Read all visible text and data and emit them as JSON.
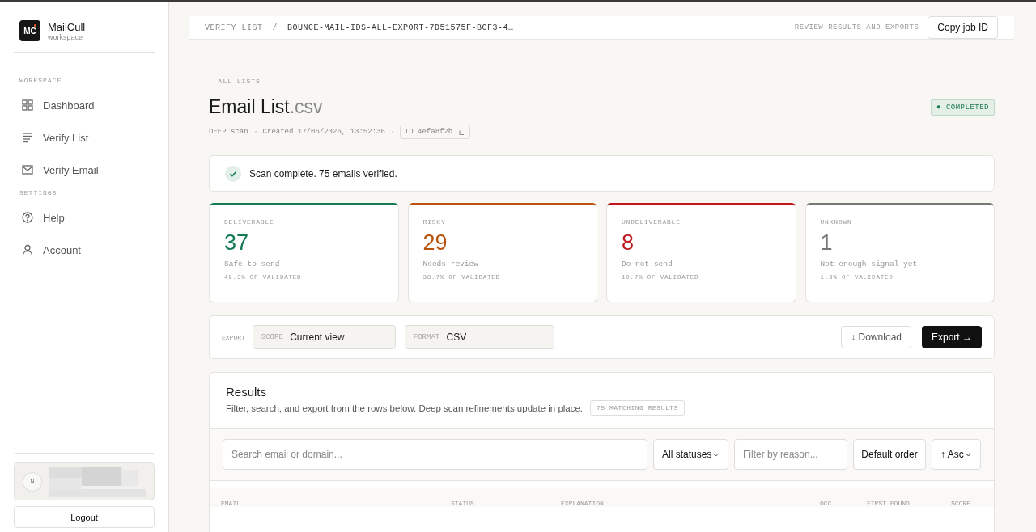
{
  "sidebar": {
    "logo": "MC",
    "brand": "MailCull",
    "subtitle": "workspace",
    "sections": [
      {
        "heading": "WORKSPACE",
        "items": [
          {
            "label": "Dashboard",
            "kind": "grid",
            "selected": false
          },
          {
            "label": "Verify List",
            "kind": "lines",
            "selected": false
          },
          {
            "label": "Verify Email",
            "kind": "mail",
            "selected": false
          }
        ]
      },
      {
        "heading": "SETTINGS",
        "items": [
          {
            "label": "Help",
            "kind": "help",
            "selected": false
          },
          {
            "label": "Account",
            "kind": "user",
            "selected": false
          }
        ]
      }
    ],
    "user": {
      "initial": "N"
    },
    "logout": "Logout"
  },
  "topbar": {
    "crumb": "VERIFY LIST",
    "separator": "/",
    "current": "BOUNCE-MAIL-IDS-ALL-EXPORT-7D51575F-BCF3-4…",
    "hint": "REVIEW RESULTS AND EXPORTS",
    "button": "Copy job ID"
  },
  "header": {
    "back": "← ALL LISTS",
    "name": "Email List",
    "ext": ".csv",
    "status": "● COMPLETED",
    "scan": "DEEP scan",
    "created": "Created 17/06/2026, 13:52:36",
    "id": "ID 4efa8f2b…"
  },
  "notice": "Scan complete. 75 emails verified.",
  "stats": [
    {
      "label": "DELIVERABLE",
      "value": "37",
      "note": "Safe to send",
      "share": "49.3% OF VALIDATED",
      "color": "#137a52"
    },
    {
      "label": "RISKY",
      "value": "29",
      "note": "Needs review",
      "share": "38.7% OF VALIDATED",
      "color": "#b8530f"
    },
    {
      "label": "UNDELIVERABLE",
      "value": "8",
      "note": "Do not send",
      "share": "10.7% OF VALIDATED",
      "color": "#c0161c"
    },
    {
      "label": "UNKNOWN",
      "value": "1",
      "note": "Not enough signal yet",
      "share": "1.3% OF VALIDATED",
      "color": "#777777"
    }
  ],
  "export": {
    "label": "EXPORT",
    "scope_label": "SCOPE",
    "scope": "Current view",
    "format_label": "FORMAT",
    "format": "CSV",
    "download": "↓ Download",
    "export": "Export →"
  },
  "results": {
    "title": "Results",
    "description": "Filter, search, and export from the rows below. Deep scan refinements update in place.",
    "count": "75 MATCHING RESULTS",
    "search_placeholder": "Search email or domain...",
    "status_filter": "All statuses",
    "reason_placeholder": "Filter by reason...",
    "order": "Default order",
    "direction": "↑ Asc",
    "columns": [
      "EMAIL",
      "STATUS",
      "EXPLANATION",
      "OCC.",
      "FIRST FOUND",
      "SCORE"
    ]
  }
}
